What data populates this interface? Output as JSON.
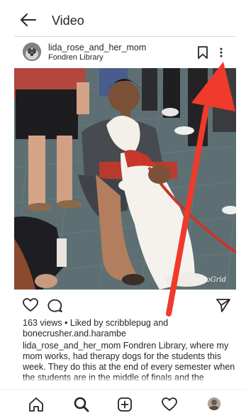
{
  "header": {
    "title": "Video",
    "back_icon": "arrow-left-icon"
  },
  "post": {
    "username": "lida_rose_and_her_mom",
    "location": "Fondren Library",
    "watermark": "PhotoGrid",
    "icons": {
      "save": "bookmark-icon",
      "more": "more-vertical-icon",
      "like": "heart-icon",
      "comment": "comment-icon",
      "share": "send-icon"
    },
    "views": "163 views",
    "liked_by_prefix": " • Liked by ",
    "liked_by_user1": "scribblepug",
    "liked_by_and": " and",
    "liked_by_user2": "bonecrusher.and.harambe",
    "caption_user": "lida_rose_and_her_mom",
    "caption_text": " Fondren Library, where my mom works, had therapy dogs for the students this week. They do this at the end of every semester when the students are in the middle of finals and the students get stressed. The dogs are so sweet and calm"
  },
  "bottom_nav": {
    "items": [
      "home-icon",
      "search-icon",
      "new-post-icon",
      "activity-heart-icon",
      "profile-avatar"
    ]
  },
  "annotation": {
    "color": "#f03a2b"
  }
}
